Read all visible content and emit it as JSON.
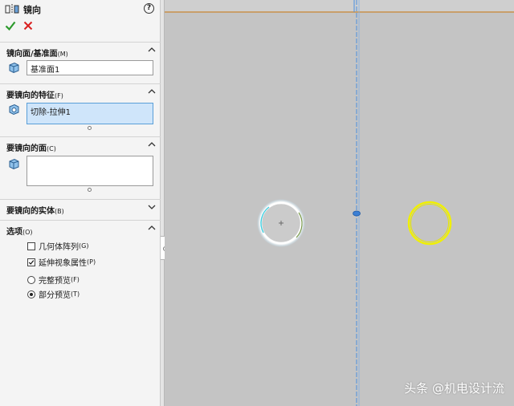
{
  "header": {
    "title": "镜向",
    "help": "?"
  },
  "sections": {
    "mirror_face": {
      "label": "镜向面/基准面",
      "shortcut": "(M)",
      "value": "基准面1"
    },
    "features": {
      "label": "要镜向的特征",
      "shortcut": "(F)",
      "value": "切除-拉伸1"
    },
    "faces": {
      "label": "要镜向的面",
      "shortcut": "(C)",
      "value": ""
    },
    "bodies": {
      "label": "要镜向的实体",
      "shortcut": "(B)"
    },
    "options": {
      "label": "选项",
      "shortcut": "(O)",
      "geometry_pattern": {
        "label": "几何体阵列",
        "shortcut": "(G)",
        "checked": false
      },
      "propagate_visual": {
        "label": "延伸视象属性",
        "shortcut": "(P)",
        "checked": true
      },
      "full_preview": {
        "label": "完整预览",
        "shortcut": "(F)",
        "selected": false
      },
      "partial_preview": {
        "label": "部分预览",
        "shortcut": "(T)",
        "selected": true
      }
    }
  },
  "watermark": "头条 @机电设计流",
  "colors": {
    "ok": "#2c9a2c",
    "cancel": "#d92020",
    "mirror_line": "#4a8fe0",
    "preview_circle": "#f0f000",
    "selected_field": "#cfe5fa",
    "viewport_bg": "#c4c4c4",
    "top_edge": "#c8904a"
  }
}
